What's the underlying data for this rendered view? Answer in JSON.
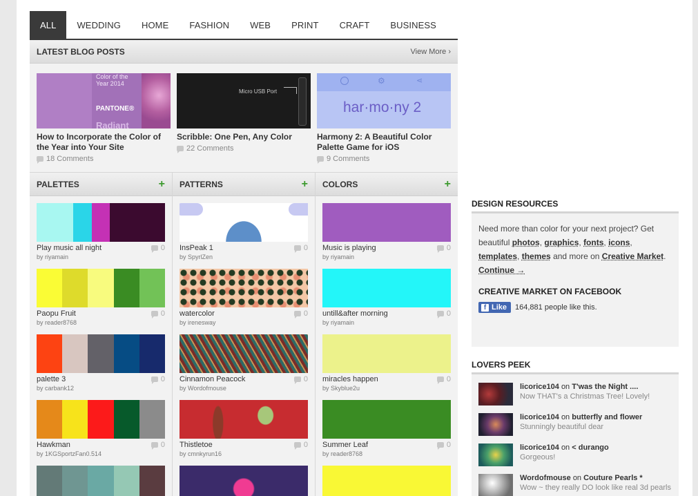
{
  "tabs": [
    "ALL",
    "WEDDING",
    "HOME",
    "FASHION",
    "WEB",
    "PRINT",
    "CRAFT",
    "BUSINESS"
  ],
  "blog": {
    "title": "LATEST BLOG POSTS",
    "view_more": "View More ›",
    "posts": [
      {
        "title": "How to Incorporate the Color of the Year into Your Site",
        "comments": "18 Comments",
        "thumb_text1": "Color of the Year 2014",
        "thumb_text2": "PANTONE®",
        "thumb_text3": "Radiant"
      },
      {
        "title": "Scribble: One Pen, Any Color",
        "comments": "22 Comments",
        "thumb_text1": "Micro  USB  Port"
      },
      {
        "title": "Harmony 2: A Beautiful Color Palette Game for iOS",
        "comments": "9 Comments",
        "thumb_text1": "har·mo·ny 2"
      }
    ]
  },
  "sections": [
    {
      "title": "PALETTES",
      "plus": "+",
      "items": [
        {
          "name": "Play music all night",
          "count": "0",
          "by": "by riyamain",
          "colors": [
            "#a8f7f1",
            "#a8f7f1",
            "#2ad5e8",
            "#c431b5",
            "#3b0a2f",
            "#3b0a2f",
            "#3b0a2f"
          ]
        },
        {
          "name": "Paopu Fruit",
          "count": "0",
          "by": "by reader8768",
          "colors": [
            "#fafc35",
            "#dedb2b",
            "#f8fb7e",
            "#3a8c23",
            "#72c257"
          ]
        },
        {
          "name": "palette 3",
          "count": "0",
          "by": "by carbank12",
          "colors": [
            "#fd4312",
            "#d8c6c0",
            "#636168",
            "#064c84",
            "#172a6c"
          ]
        },
        {
          "name": "Hawkman",
          "count": "0",
          "by": "by 1KGSportzFan0.514",
          "colors": [
            "#e5891a",
            "#f7e31b",
            "#fc1a1a",
            "#075a2b",
            "#8b8b8b"
          ]
        },
        {
          "name": "",
          "count": "",
          "by": "",
          "colors": [
            "#637a77",
            "#6f9692",
            "#6aa9a4",
            "#95c8b4",
            "#5a3c40"
          ]
        }
      ]
    },
    {
      "title": "PATTERNS",
      "plus": "+",
      "items": [
        {
          "name": "InsPeak 1",
          "count": "0",
          "by": "by SpyrlZen",
          "pattern": "peak"
        },
        {
          "name": "watercolor",
          "count": "0",
          "by": "by irenesway",
          "pattern": "dots"
        },
        {
          "name": "Cinnamon Peacock",
          "count": "0",
          "by": "by Wordofmouse",
          "pattern": "peacock"
        },
        {
          "name": "Thistletoe",
          "count": "0",
          "by": "by cmnkyrun16",
          "pattern": "thistle"
        },
        {
          "name": "",
          "count": "",
          "by": "",
          "pattern": "flower"
        }
      ]
    },
    {
      "title": "COLORS",
      "plus": "+",
      "items": [
        {
          "name": "Music is playing",
          "count": "0",
          "by": "by riyamain",
          "colors": [
            "#a05cbf"
          ]
        },
        {
          "name": "untill&after morning",
          "count": "0",
          "by": "by riyamain",
          "colors": [
            "#23f6f9"
          ]
        },
        {
          "name": "miracles happen",
          "count": "0",
          "by": "by Skyblue2u",
          "colors": [
            "#ecf28b"
          ]
        },
        {
          "name": "Summer Leaf",
          "count": "0",
          "by": "by reader8768",
          "colors": [
            "#3a8c23"
          ]
        },
        {
          "name": "",
          "count": "",
          "by": "",
          "colors": [
            "#f9f835"
          ]
        }
      ]
    }
  ],
  "design_resources": {
    "title": "DESIGN RESOURCES",
    "text_a": "Need more than color for your next project? Get beautiful ",
    "links": [
      "photos",
      "graphics",
      "fonts",
      "icons",
      "templates",
      "themes"
    ],
    "text_b": " and more on ",
    "market": "Creative Market",
    "cont": "Continue →"
  },
  "facebook": {
    "title": "CREATIVE MARKET ON FACEBOOK",
    "like": "Like",
    "count_text": "164,881 people like this."
  },
  "lovers_peek": {
    "title": "LOVERS PEEK",
    "entries": [
      {
        "user": "licorice104",
        "on": "on",
        "target": "T'was the Night ....",
        "comment": "Now THAT's a Christmas Tree! Lovely!"
      },
      {
        "user": "licorice104",
        "on": "on",
        "target": "butterfly and flower",
        "comment": "Stunningly beautiful dear"
      },
      {
        "user": "licorice104",
        "on": "on",
        "target": "< durango",
        "comment": "Gorgeous!"
      },
      {
        "user": "Wordofmouse",
        "on": "on",
        "target": "Couture Pearls *",
        "comment": "Wow ~ they really DO look like real 3d pearls"
      }
    ]
  }
}
